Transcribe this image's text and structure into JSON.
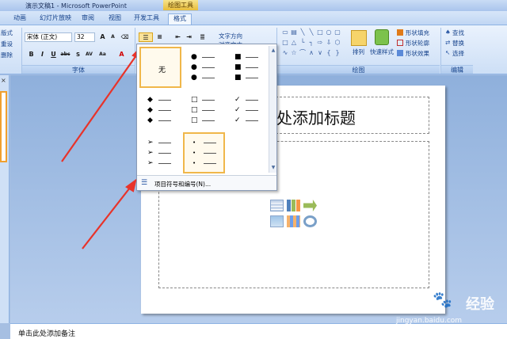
{
  "window": {
    "title": "演示文稿1 - Microsoft PowerPoint",
    "context_tab": "绘图工具"
  },
  "tabs": [
    "动画",
    "幻灯片放映",
    "审阅",
    "视图",
    "开发工具",
    "格式"
  ],
  "ribbon": {
    "left_items": [
      "版式",
      "重设",
      "删除"
    ],
    "font_name": "宋体 (正文)",
    "font_size": "32",
    "font_group_label": "字体",
    "drawing_group_label": "绘图",
    "editing_group_label": "编辑",
    "text_direction": "文字方向",
    "align_text": "对齐文本",
    "arrange": "排列",
    "quick_styles": "快速样式",
    "shape_fill": "形状填充",
    "shape_outline": "形状轮廓",
    "shape_effects": "形状效果",
    "find": "查找",
    "replace": "替换",
    "select": "选择"
  },
  "gallery": {
    "none_label": "无",
    "footer_label": "项目符号和编号(N)..."
  },
  "slide": {
    "title_placeholder": "处添加标题"
  },
  "notes": {
    "placeholder": "单击此处添加备注"
  },
  "watermark": {
    "brand": "Bai",
    "brand2": "经验",
    "url": "jingyan.baidu.com"
  }
}
